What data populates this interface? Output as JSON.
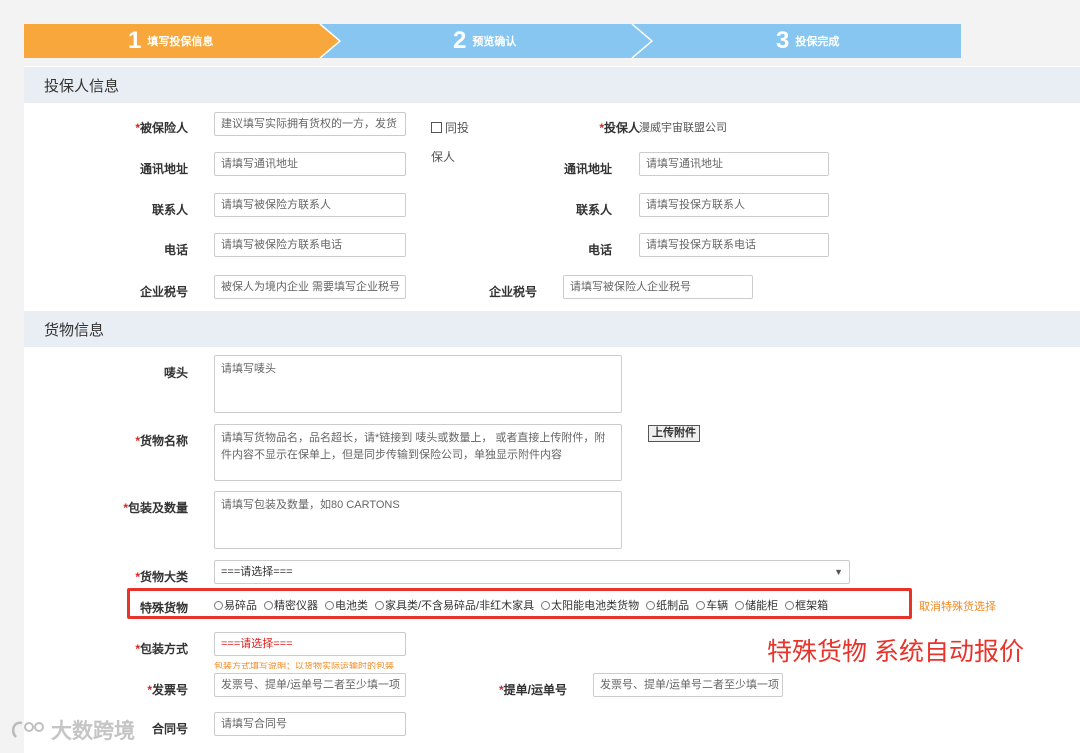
{
  "steps": [
    {
      "num": "1",
      "label": "填写投保信息",
      "color": "#f7a73b"
    },
    {
      "num": "2",
      "label": "预览确认",
      "color": "#86c6f0"
    },
    {
      "num": "3",
      "label": "投保完成",
      "color": "#86c6f0"
    }
  ],
  "policyholder_section": {
    "title": "投保人信息",
    "insured_label": "被保险人",
    "insured_placeholder": "建议填写实际拥有货权的一方，发货",
    "same_as_label_1": "同投",
    "same_as_label_2": "保人",
    "holder_label": "投保人",
    "holder_value": "漫威宇宙联盟公司",
    "address_label": "通讯地址",
    "address_placeholder": "请填写通讯地址",
    "holder_address_label": "通讯地址",
    "holder_address_placeholder": "请填写通讯地址",
    "contact_label": "联系人",
    "contact_placeholder": "请填写被保险方联系人",
    "holder_contact_label": "联系人",
    "holder_contact_placeholder": "请填写投保方联系人",
    "phone_label": "电话",
    "phone_placeholder": "请填写被保险方联系电话",
    "holder_phone_label": "电话",
    "holder_phone_placeholder": "请填写投保方联系电话",
    "tax_label": "企业税号",
    "tax_placeholder": "被保人为境内企业 需要填写企业税号",
    "holder_tax_label": "企业税号",
    "holder_tax_placeholder": "请填写被保险人企业税号"
  },
  "cargo_section": {
    "title": "货物信息",
    "marks_label": "唛头",
    "marks_placeholder": "请填写唛头",
    "goods_name_label": "货物名称",
    "goods_name_placeholder": "请填写货物品名，品名超长，请*链接到 唛头或数量上， 或者直接上传附件，附件内容不显示在保单上，但是同步传输到保险公司，单独显示附件内容",
    "upload_button": "上传附件",
    "packing_label": "包装及数量",
    "packing_placeholder": "请填写包装及数量，如80 CARTONS",
    "category_label": "货物大类",
    "category_value": "===请选择===",
    "special_label": "特殊货物",
    "special_options": [
      "易碎品",
      "精密仪器",
      "电池类",
      "家具类/不含易碎品/非红木家具",
      "太阳能电池类货物",
      "纸制品",
      "车辆",
      "储能柜",
      "框架箱"
    ],
    "cancel_special": "取消特殊货选择",
    "annotation": "特殊货物 系统自动报价",
    "pack_method_label": "包装方式",
    "pack_method_value": "===请选择===",
    "pack_method_hint": "包装方式填写说明：以货物实际运输时的包装",
    "invoice_label": "发票号",
    "invoice_placeholder": "发票号、提单/运单号二者至少填一项",
    "bl_label": "提单/运单号",
    "bl_placeholder": "发票号、提单/运单号二者至少填一项",
    "contract_label": "合同号",
    "contract_placeholder": "请填写合同号"
  },
  "watermark": "大数跨境",
  "colors": {
    "accent_orange": "#f7a73b",
    "step_blue": "#86c6f0",
    "required_red": "#e02020",
    "highlight_red": "#e8332a"
  }
}
